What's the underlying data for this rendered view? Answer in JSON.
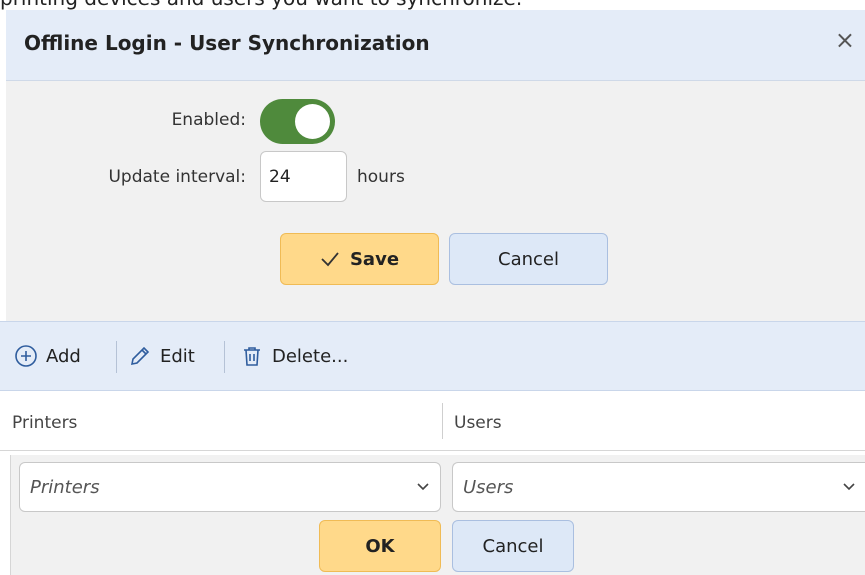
{
  "intro_text": "printing devices and users you want to synchronize.",
  "dialog": {
    "title": "Offline Login - User Synchronization",
    "close_glyph": "×"
  },
  "settings": {
    "enabled_label": "Enabled:",
    "enabled_value": true,
    "interval_label": "Update interval:",
    "interval_value": "24",
    "interval_unit": "hours",
    "save_label": "Save",
    "cancel_label": "Cancel"
  },
  "toolbar": {
    "add_label": "Add",
    "edit_label": "Edit",
    "delete_label": "Delete..."
  },
  "grid": {
    "columns": [
      "Printers",
      "Users"
    ]
  },
  "editor": {
    "printers_placeholder": "Printers",
    "users_placeholder": "Users",
    "ok_label": "OK",
    "cancel_label": "Cancel"
  },
  "colors": {
    "toggle_on": "#4f8a3c",
    "primary_button": "#ffd98a",
    "secondary_button": "#dde8f7",
    "header_bg": "#e4ecf8"
  }
}
